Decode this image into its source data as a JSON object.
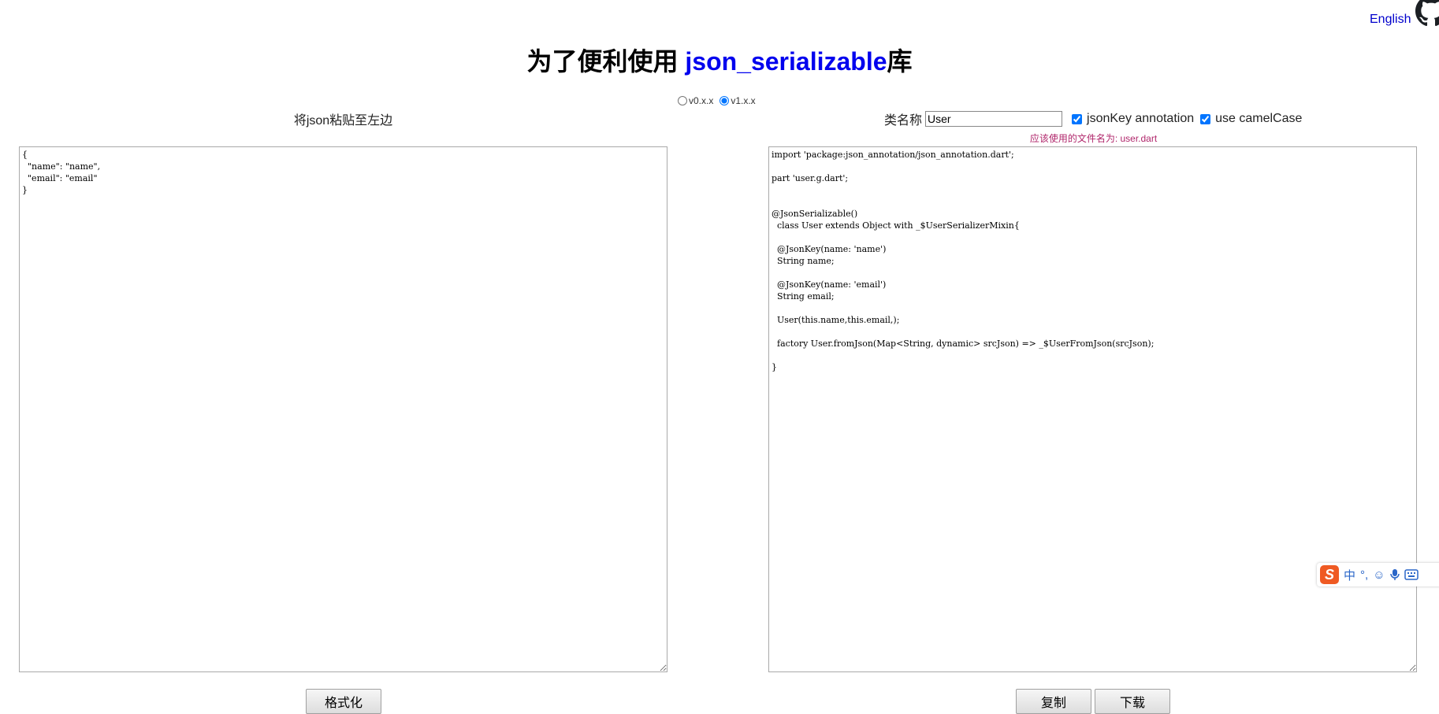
{
  "header": {
    "language_link": "English",
    "github_icon": "github-icon"
  },
  "title": {
    "prefix": "为了便利使用 ",
    "library": "json_serializable",
    "suffix": "库"
  },
  "version": {
    "options": [
      {
        "label": "v0.x.x",
        "checked": false
      },
      {
        "label": "v1.x.x",
        "checked": true
      }
    ]
  },
  "left": {
    "heading": "将json粘贴至左边",
    "json_text": "{\n  \"name\": \"name\",\n  \"email\": \"email\"\n}",
    "format_button": "格式化"
  },
  "right": {
    "class_name_label": "类名称",
    "class_name_value": "User",
    "json_key_label": "jsonKey annotation",
    "json_key_checked": true,
    "camel_case_label": "use camelCase",
    "camel_case_checked": true,
    "filename_hint": "应该使用的文件名为: user.dart",
    "code_text": "import 'package:json_annotation/json_annotation.dart';\n\npart 'user.g.dart';\n\n\n@JsonSerializable()\n  class User extends Object with _$UserSerializerMixin{\n\n  @JsonKey(name: 'name')\n  String name;\n\n  @JsonKey(name: 'email')\n  String email;\n\n  User(this.name,this.email,);\n\n  factory User.fromJson(Map<String, dynamic> srcJson) => _$UserFromJson(srcJson);\n\n}",
    "copy_button": "复制",
    "download_button": "下载"
  },
  "ime_toolbar": {
    "logo": "S",
    "items": [
      "中",
      "°,",
      "☺",
      "mic-icon",
      "keyboard-icon"
    ]
  },
  "colors": {
    "library_title": "#0000ee",
    "link": "#0000cc",
    "hint": "#b0266b",
    "ime_logo": "#ef5a23"
  }
}
